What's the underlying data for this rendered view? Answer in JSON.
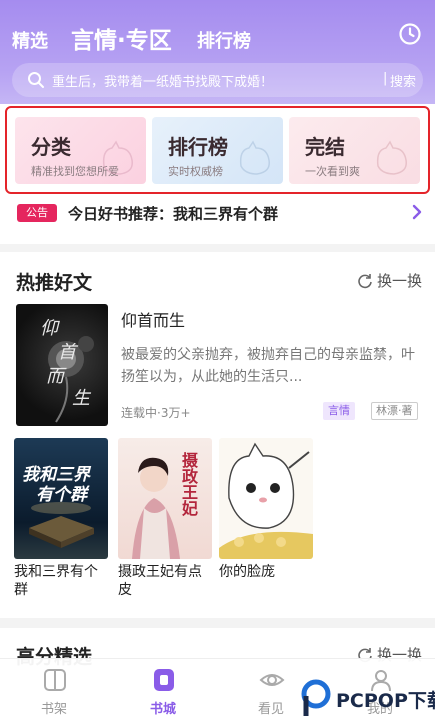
{
  "header": {
    "tabs": [
      {
        "label": "精选"
      },
      {
        "label": "言情·专区"
      },
      {
        "label": "排行榜"
      }
    ],
    "history_icon": "clock-icon"
  },
  "search": {
    "placeholder": "重生后，我带着一纸婚书找殿下成婚！",
    "divider": "|",
    "button": "搜索"
  },
  "quick_entries": [
    {
      "title": "分类",
      "subtitle": "精准找到您想所爱"
    },
    {
      "title": "排行榜",
      "subtitle": "实时权威榜"
    },
    {
      "title": "完结",
      "subtitle": "一次看到爽"
    }
  ],
  "notice": {
    "badge": "公告",
    "text": "今日好书推荐：我和三界有个群"
  },
  "hot_section": {
    "title": "热推好文",
    "refresh_label": "换一换",
    "featured": {
      "title": "仰首而生",
      "cover_text": "仰首而生",
      "description": "被最爱的父亲抛弃，被抛弃自己的母亲监禁，叶扬笙以为，从此她的生活只...",
      "meta": "连载中·3万+",
      "tag": "言情",
      "author": "林漂·著"
    },
    "books": [
      {
        "title": "我和三界有个群",
        "cover_text": "我和三界有个群"
      },
      {
        "title": "摄政王妃有点皮",
        "cover_text": "摄政王妃"
      },
      {
        "title": "你的脸庞"
      }
    ]
  },
  "high_section": {
    "title": "高分精选",
    "refresh_label": "换一换"
  },
  "tabbar": [
    {
      "label": "书架",
      "icon": "bookshelf-icon"
    },
    {
      "label": "书城",
      "icon": "bookstore-icon",
      "active": true
    },
    {
      "label": "看见",
      "icon": "eye-icon"
    },
    {
      "label": "我的",
      "icon": "user-icon"
    }
  ],
  "watermark": {
    "text": "PCPOP下载"
  },
  "colors": {
    "header": "#a58cef",
    "accent": "#8a5ce8",
    "highlight_border": "#e4242a",
    "notice_badge": "#e5265e"
  }
}
